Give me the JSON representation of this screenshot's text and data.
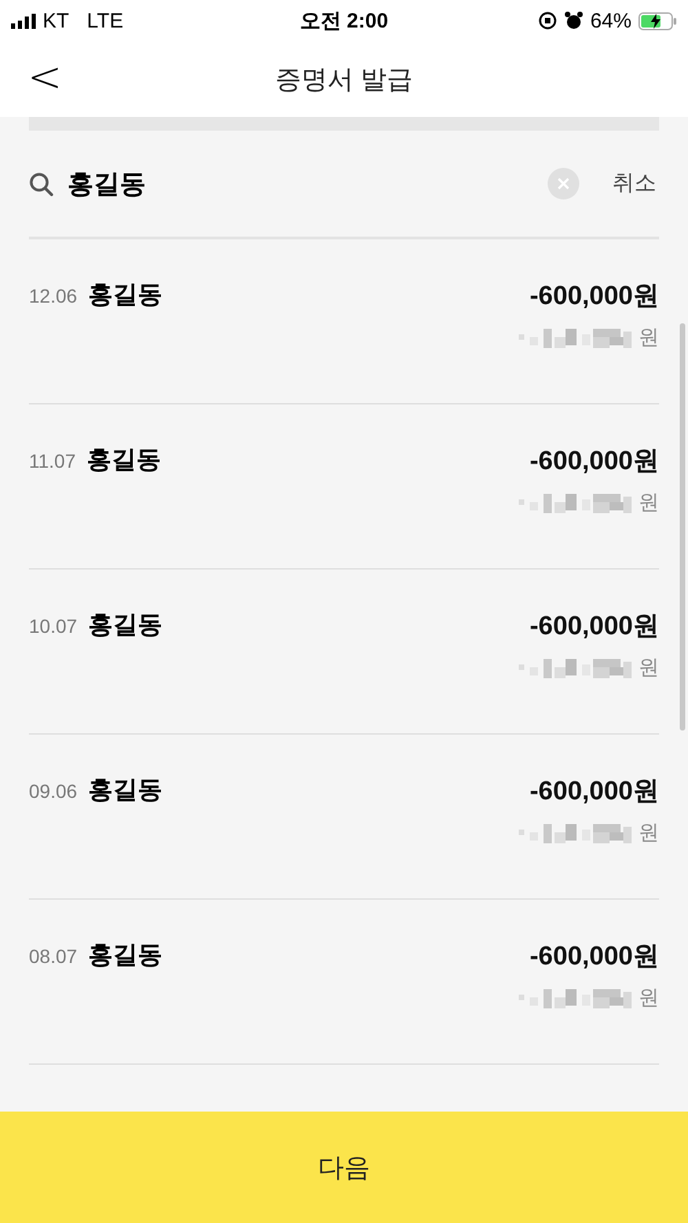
{
  "status_bar": {
    "carrier": "KT",
    "network": "LTE",
    "time": "오전 2:00",
    "battery": "64%"
  },
  "header": {
    "back": "<",
    "title": "증명서 발급"
  },
  "search": {
    "value": "홍길동",
    "cancel": "취소"
  },
  "transactions": [
    {
      "date": "12.06",
      "name": "홍길동",
      "amount": "-600,000원",
      "balance_unit": "원"
    },
    {
      "date": "11.07",
      "name": "홍길동",
      "amount": "-600,000원",
      "balance_unit": "원"
    },
    {
      "date": "10.07",
      "name": "홍길동",
      "amount": "-600,000원",
      "balance_unit": "원"
    },
    {
      "date": "09.06",
      "name": "홍길동",
      "amount": "-600,000원",
      "balance_unit": "원"
    },
    {
      "date": "08.07",
      "name": "홍길동",
      "amount": "-600,000원",
      "balance_unit": "원"
    }
  ],
  "next_button": "다음"
}
